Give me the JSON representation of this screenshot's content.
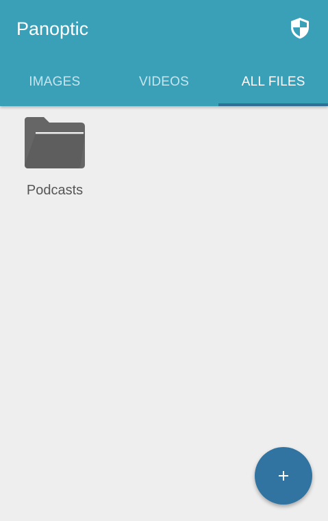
{
  "app_bar": {
    "title": "Panoptic",
    "security_icon": "shield-icon"
  },
  "tabs": [
    {
      "label": "IMAGES",
      "active": false
    },
    {
      "label": "VIDEOS",
      "active": false
    },
    {
      "label": "ALL FILES",
      "active": true
    }
  ],
  "files": [
    {
      "name": "Podcasts",
      "icon": "folder-icon"
    }
  ],
  "fab": {
    "icon": "plus-icon"
  },
  "colors": {
    "primary": "#3aa0b8",
    "tab_indicator": "#2f6f96",
    "fab": "#3173a1",
    "background": "#eeeeee",
    "folder": "#666666"
  }
}
